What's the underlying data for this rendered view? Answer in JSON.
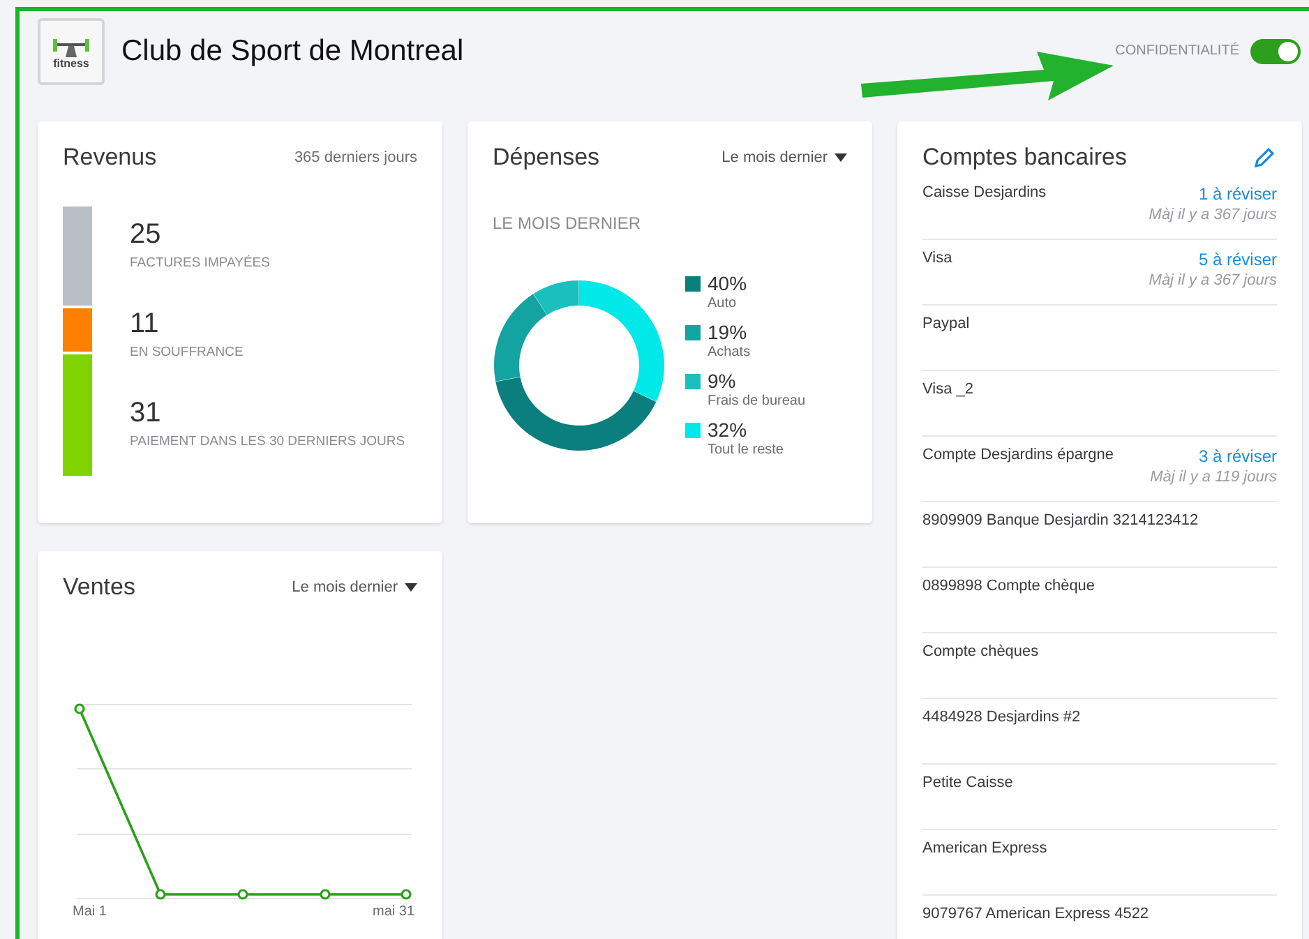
{
  "header": {
    "logo_text": "fitness",
    "title": "Club de Sport de Montreal"
  },
  "privacy": {
    "label": "CONFIDENTIALITÉ",
    "on": true
  },
  "revenue": {
    "title": "Revenus",
    "period": "365 derniers jours",
    "items": [
      {
        "count": "25",
        "label": "FACTURES IMPAYÉES",
        "color": "#babec5"
      },
      {
        "count": "11",
        "label": "EN SOUFFRANCE",
        "color": "#ff8000"
      },
      {
        "count": "31",
        "label": "PAIEMENT DANS LES 30 DERNIERS JOURS",
        "color": "#7fd400"
      }
    ]
  },
  "expenses": {
    "title": "Dépenses",
    "period": "Le mois dernier",
    "subtitle": "LE MOIS DERNIER",
    "legend": [
      {
        "value": "40%",
        "color": "#0b7f7d"
      },
      {
        "value": "19%",
        "color": "#13a3a0"
      },
      {
        "value": "9%",
        "color": "#1ac0be"
      },
      {
        "value": "32%",
        "color": "#00e9e8"
      }
    ],
    "chart_data": {
      "type": "donut",
      "categories": [
        "Auto",
        "Achats",
        "Frais de bureau",
        "Tout le reste"
      ],
      "values": [
        40,
        19,
        9,
        32
      ]
    }
  },
  "sales": {
    "title": "Ventes",
    "period": "Le mois dernier",
    "x_start": "Mai 1",
    "x_end": "mai 31"
  },
  "accounts": {
    "title": "Comptes bancaires",
    "items": [
      {
        "name": "Caisse Desjardins",
        "review": "1 à réviser",
        "updated": "Màj il y a 367 jours"
      },
      {
        "name": "Visa",
        "review": "5 à réviser",
        "updated": "Màj il y a 367 jours"
      },
      {
        "name": "Paypal"
      },
      {
        "name": "Visa _2"
      },
      {
        "name": "Compte Desjardins épargne",
        "review": "3 à réviser",
        "updated": "Màj il y a 119 jours"
      },
      {
        "name": "8909909 Banque Desjardin 3214123412"
      },
      {
        "name": "0899898 Compte chèque"
      },
      {
        "name": "Compte chèques"
      },
      {
        "name": "4484928 Desjardins #2"
      },
      {
        "name": "Petite Caisse"
      },
      {
        "name": "American Express"
      },
      {
        "name": "9079767 American Express 4522"
      }
    ]
  }
}
